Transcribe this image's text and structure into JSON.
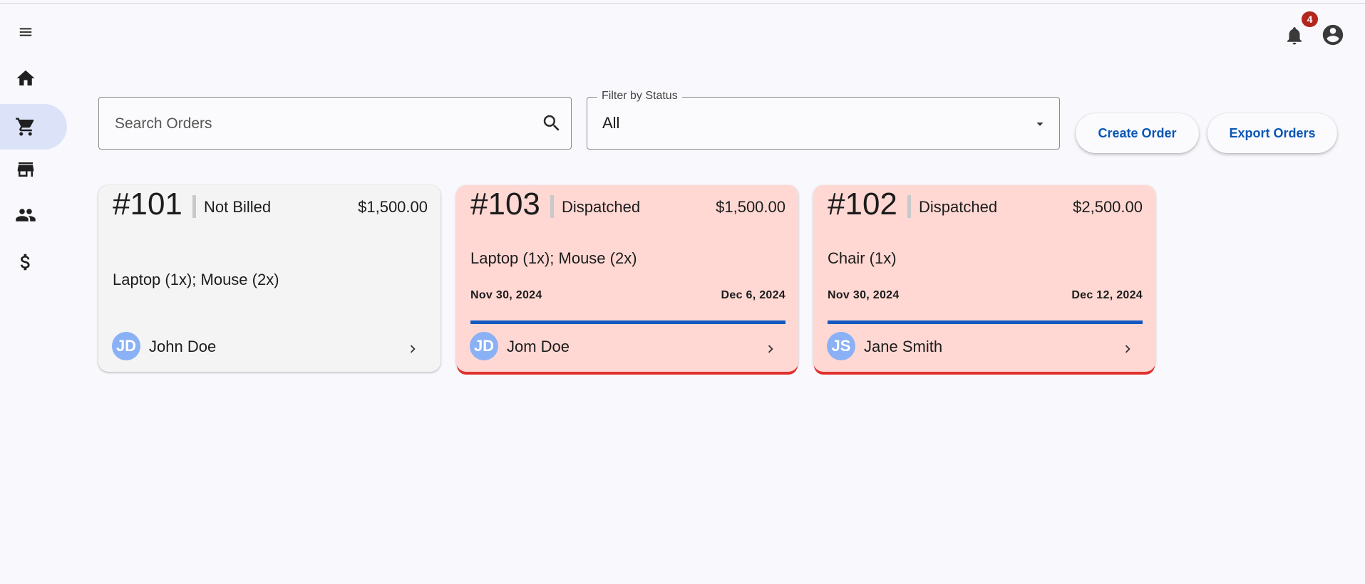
{
  "header": {
    "notification_count": "4"
  },
  "sidebar": {
    "items": [
      {
        "icon": "home-icon",
        "active": false
      },
      {
        "icon": "shopping-cart-icon",
        "active": true
      },
      {
        "icon": "store-icon",
        "active": false
      },
      {
        "icon": "people-icon",
        "active": false
      },
      {
        "icon": "dollar-icon",
        "active": false
      }
    ]
  },
  "toolbar": {
    "search_placeholder": "Search Orders",
    "filter_label": "Filter by Status",
    "filter_value": "All",
    "create_label": "Create Order",
    "export_label": "Export Orders"
  },
  "orders": [
    {
      "number": "#101",
      "status": "Not Billed",
      "amount": "$1,500.00",
      "items": "Laptop (1x); Mouse (2x)",
      "initials": "JD",
      "customer": "John Doe"
    },
    {
      "number": "#103",
      "status": "Dispatched",
      "amount": "$1,500.00",
      "items": "Laptop (1x); Mouse (2x)",
      "start_date": "Nov 30, 2024",
      "end_date": "Dec 6, 2024",
      "progress": 1.0,
      "initials": "JD",
      "customer": "Jom Doe"
    },
    {
      "number": "#102",
      "status": "Dispatched",
      "amount": "$2,500.00",
      "items": "Chair (1x)",
      "start_date": "Nov 30, 2024",
      "end_date": "Dec 12, 2024",
      "progress": 1.0,
      "initials": "JS",
      "customer": "Jane Smith"
    }
  ],
  "colors": {
    "accent": "#0a56b6",
    "active_nav": "#dce3f9",
    "card_alert": "#ffd8d3",
    "card_default": "#f4f4f5",
    "badge": "#b3261e",
    "avatar": "#8ab1f5"
  }
}
